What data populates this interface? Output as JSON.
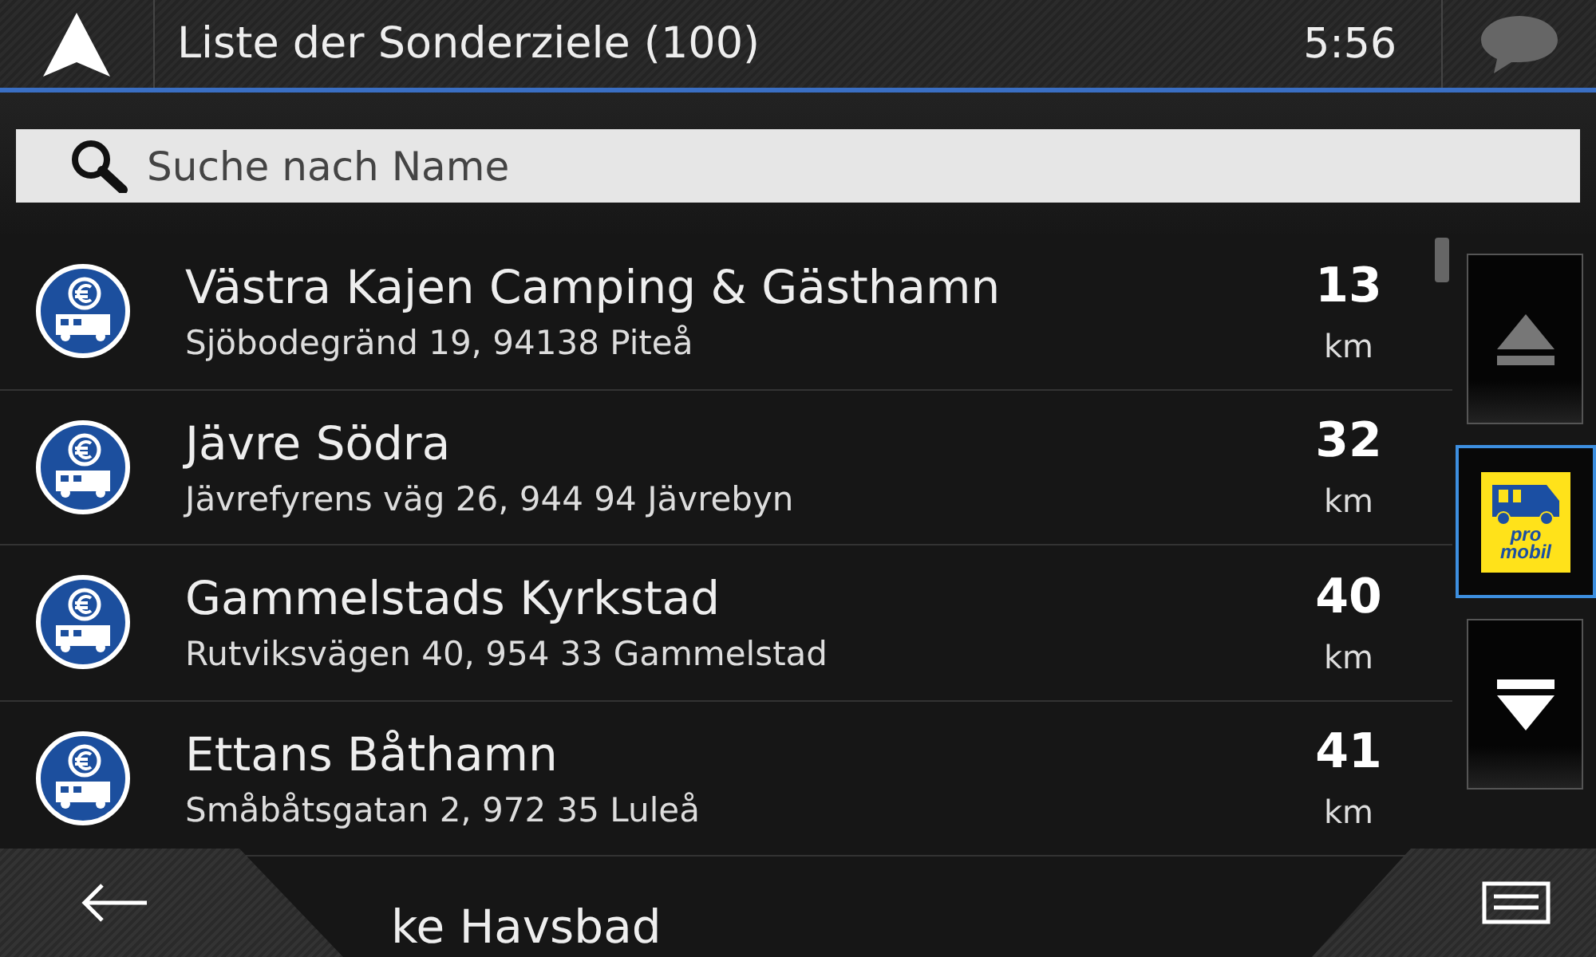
{
  "header": {
    "title": "Liste der Sonderziele (100)",
    "time": "5:56"
  },
  "search": {
    "placeholder": "Suche nach Name"
  },
  "places": [
    {
      "kind": "place",
      "name": "Västra Kajen Camping & Gästhamn",
      "address": "Sjöbodegränd 19, 94138 Piteå",
      "distance": "13",
      "unit": "km"
    },
    {
      "kind": "place",
      "name": "Jävre Södra",
      "address": "Jävrefyrens väg 26, 944 94 Jävrebyn",
      "distance": "32",
      "unit": "km"
    },
    {
      "kind": "place",
      "name": "Gammelstads Kyrkstad",
      "address": "Rutviksvägen 40, 954 33 Gammelstad",
      "distance": "40",
      "unit": "km"
    },
    {
      "kind": "place",
      "name": "Ettans Båthamn",
      "address": "Småbåtsgatan 2, 972 35 Luleå",
      "distance": "41",
      "unit": "km"
    },
    {
      "kind": "cut-off",
      "name": "ke Havsbad"
    }
  ],
  "side_buttons": [
    {
      "kind": "up",
      "selected": false,
      "disabled": true
    },
    {
      "kind": "logo",
      "selected": true,
      "logo_text": [
        "pro",
        "mobil"
      ]
    },
    {
      "kind": "down",
      "selected": false,
      "disabled": false
    }
  ]
}
